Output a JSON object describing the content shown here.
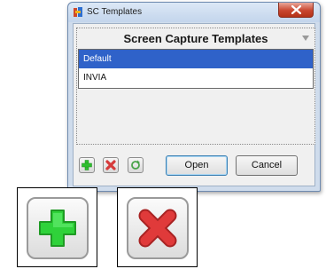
{
  "window": {
    "title": "SC Templates"
  },
  "panel": {
    "header": "Screen Capture Templates"
  },
  "templates": [
    {
      "label": "Default",
      "selected": true
    },
    {
      "label": "INVIA",
      "selected": false
    }
  ],
  "buttons": {
    "open_label": "Open",
    "cancel_label": "Cancel"
  },
  "icons": {
    "add": "plus-icon",
    "delete": "x-icon",
    "refresh": "refresh-icon",
    "close": "close-icon",
    "dropdown": "chevron-down-icon"
  },
  "colors": {
    "selection": "#2f62c9",
    "add_green": "#2fbf2f",
    "delete_red": "#d63b3b"
  }
}
